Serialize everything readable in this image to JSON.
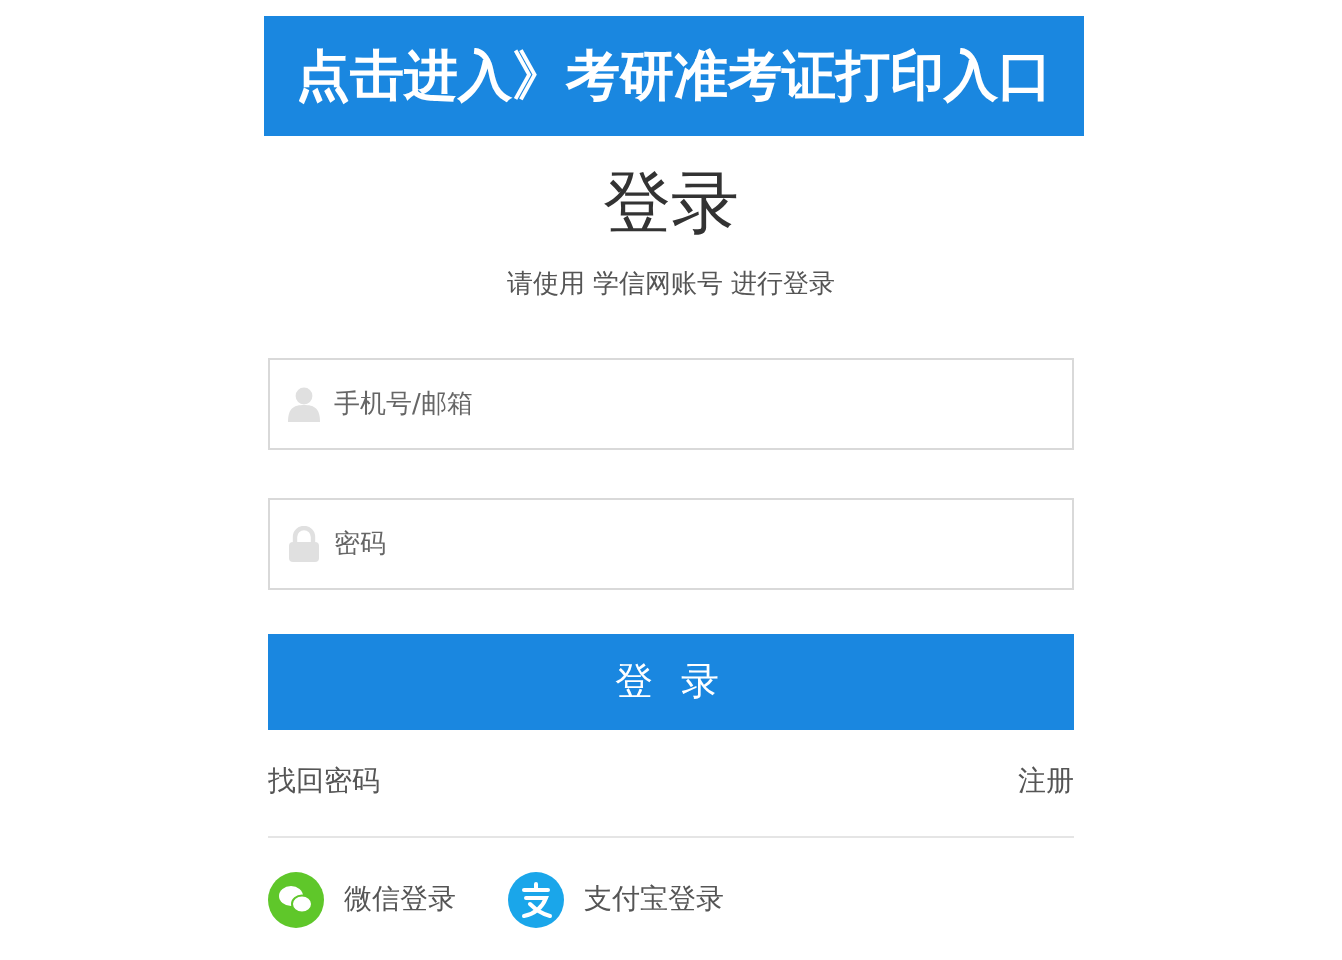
{
  "banner": {
    "text": "点击进入》考研准考证打印入口"
  },
  "title": "登录",
  "subtitle": "请使用 学信网账号 进行登录",
  "fields": [
    {
      "kind": "user",
      "placeholder": "手机号/邮箱"
    },
    {
      "kind": "lock",
      "placeholder": "密码"
    }
  ],
  "login_button": "登 录",
  "links": {
    "left": "找回密码",
    "right": "注册"
  },
  "social_logins": [
    {
      "kind": "wechat",
      "label": "微信登录"
    },
    {
      "kind": "alipay",
      "label": "支付宝登录"
    }
  ]
}
